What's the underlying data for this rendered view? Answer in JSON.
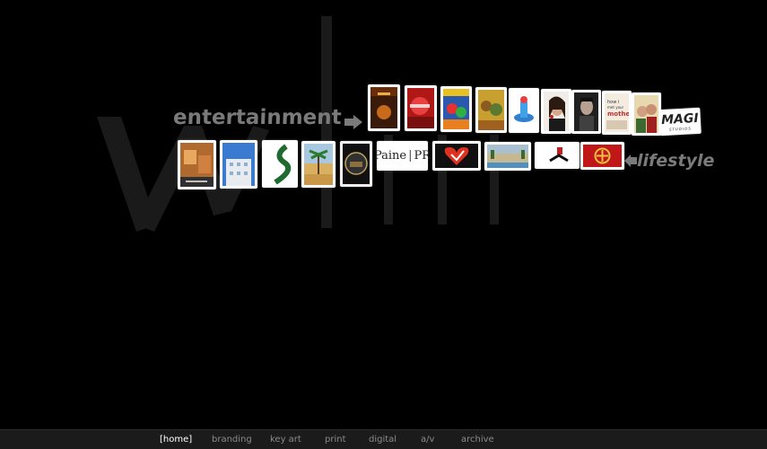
{
  "categories": {
    "entertainment": "entertainment",
    "lifestyle": "lifestyle"
  },
  "thumbnails": {
    "entertainment_row": [
      {
        "name": "poster-orange-dark"
      },
      {
        "name": "poster-red-rolling"
      },
      {
        "name": "poster-colorful-adventure"
      },
      {
        "name": "poster-yellow-characters"
      },
      {
        "name": "poster-blue-toy"
      },
      {
        "name": "poster-woman-portrait"
      },
      {
        "name": "poster-man-portrait"
      },
      {
        "name": "poster-how-i-met-your-mother",
        "text": "how i met your mother"
      },
      {
        "name": "poster-couple"
      },
      {
        "name": "logo-magi",
        "text": "MAGI",
        "subtext": "STUDIOS"
      }
    ],
    "lifestyle_row": [
      {
        "name": "photo-orange-interior"
      },
      {
        "name": "photo-building-sky"
      },
      {
        "name": "logo-green-road"
      },
      {
        "name": "photo-palm-tree"
      },
      {
        "name": "logo-round-badge"
      },
      {
        "name": "logo-paine-pr",
        "text_left": "Paine",
        "text_right": "PR"
      },
      {
        "name": "logo-red-heart"
      },
      {
        "name": "photo-resort-pool"
      },
      {
        "name": "logo-figure-red"
      },
      {
        "name": "logo-red-emblem"
      }
    ]
  },
  "nav": {
    "items": [
      {
        "label": "[home]",
        "active": true
      },
      {
        "label": "branding",
        "active": false
      },
      {
        "label": "key art",
        "active": false
      },
      {
        "label": "print",
        "active": false
      },
      {
        "label": "digital",
        "active": false
      },
      {
        "label": "a/v",
        "active": false
      },
      {
        "label": "archive",
        "active": false
      }
    ]
  },
  "colors": {
    "background": "#000000",
    "label_gray": "#7a7a7a",
    "nav_bg": "#1b1b1b",
    "nav_text": "#8a8a8a",
    "nav_active": "#ffffff"
  }
}
